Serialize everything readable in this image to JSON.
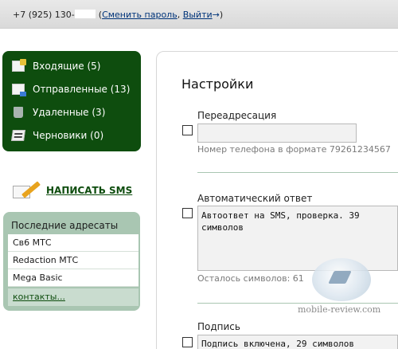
{
  "header": {
    "phone": "+7 (925) 130-",
    "change_password": "Сменить пароль",
    "sep": ",",
    "logout": "Выйти",
    "open_paren": "(",
    "close_paren": ")",
    "arrow": "→"
  },
  "folders": [
    {
      "label": "Входящие (5)",
      "icon": "inbox-icon"
    },
    {
      "label": "Отправленные (13)",
      "icon": "sent-icon"
    },
    {
      "label": "Удаленные (3)",
      "icon": "trash-icon"
    },
    {
      "label": "Черновики (0)",
      "icon": "drafts-icon"
    }
  ],
  "write_sms": "НАПИСАТЬ SMS",
  "recent": {
    "title": "Последние адресаты",
    "items": [
      "Св6 МТС",
      "Redaction МТС",
      "Mega Basic"
    ],
    "more": "контакты..."
  },
  "settings": {
    "title": "Настройки",
    "forward": {
      "label": "Переадресация",
      "value": "",
      "hint": "Номер телефона в формате 79261234567"
    },
    "autoreply": {
      "label": "Автоматический ответ",
      "value": "Автоответ на SMS, проверка. 39 символов",
      "hint": "Осталось символов: 61"
    },
    "signature": {
      "label": "Подпись",
      "value": "Подпись включена, 29 символов"
    }
  },
  "watermark": "mobile-review.com",
  "colors": {
    "dark_green": "#0e4d0e",
    "sage": "#a9c6b2",
    "link_blue": "#00347a"
  }
}
